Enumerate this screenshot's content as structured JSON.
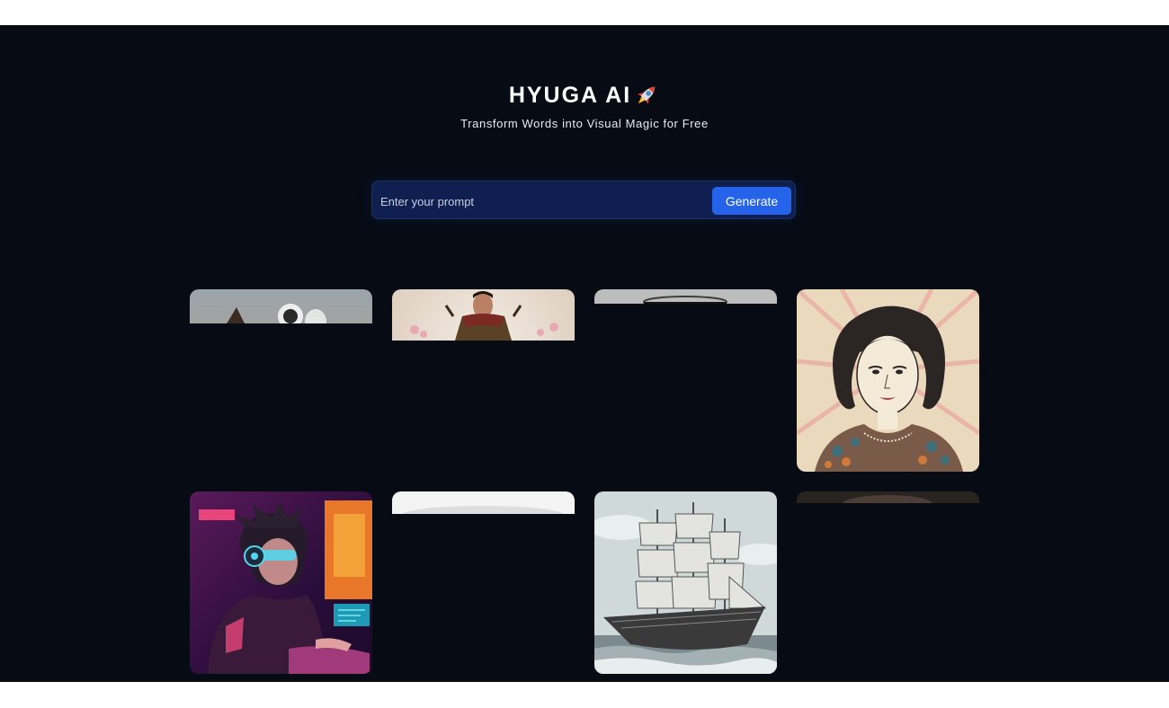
{
  "app": {
    "title": "HYUGA AI",
    "title_icon": "rocket-icon",
    "subtitle": "Transform Words into Visual Magic for Free"
  },
  "prompt": {
    "placeholder": "Enter your prompt",
    "value": "",
    "button_label": "Generate"
  },
  "gallery": {
    "items": [
      {
        "subject": "astronaut",
        "state": "loading"
      },
      {
        "subject": "samurai",
        "state": "loading"
      },
      {
        "subject": "jar",
        "state": "loading"
      },
      {
        "subject": "retro-woman-portrait",
        "state": "loaded"
      },
      {
        "subject": "cyberpunk-gamer",
        "state": "loaded"
      },
      {
        "subject": "white-object",
        "state": "loading"
      },
      {
        "subject": "sailing-ship-sketch",
        "state": "loaded"
      },
      {
        "subject": "dark-portrait",
        "state": "loading"
      }
    ]
  },
  "colors": {
    "background": "#060b14",
    "prompt_bar": "#0f2050",
    "button": "#2563eb"
  }
}
